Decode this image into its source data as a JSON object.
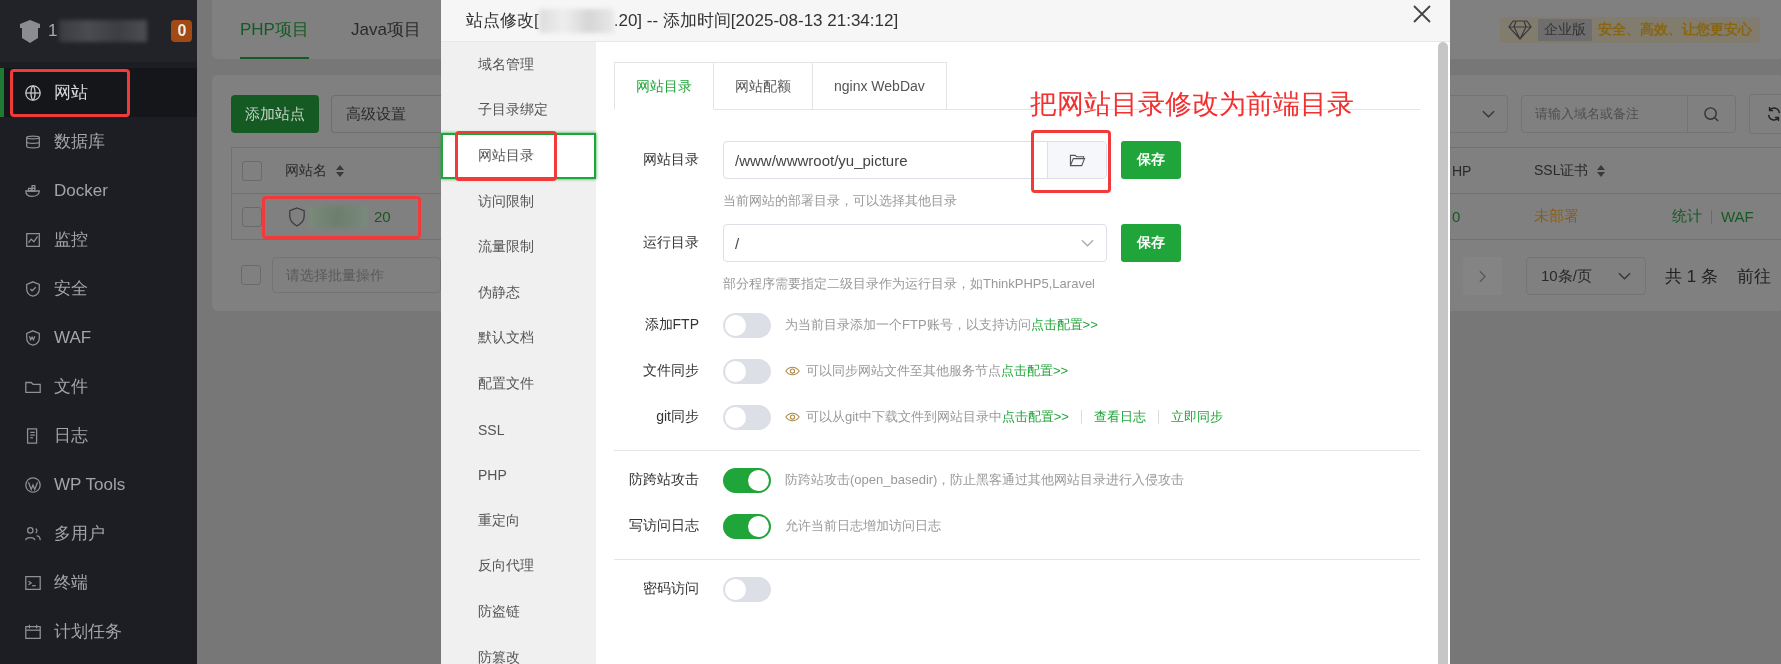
{
  "sidebar": {
    "brand_prefix": "1",
    "badge": "0",
    "items": [
      {
        "label": "网站",
        "selected": true,
        "annotated": true
      },
      {
        "label": "数据库",
        "selected": false,
        "annotated": false
      },
      {
        "label": "Docker",
        "selected": false,
        "annotated": false
      },
      {
        "label": "监控",
        "selected": false,
        "annotated": false
      },
      {
        "label": "安全",
        "selected": false,
        "annotated": false
      },
      {
        "label": "WAF",
        "selected": false,
        "annotated": false
      },
      {
        "label": "文件",
        "selected": false,
        "annotated": false
      },
      {
        "label": "日志",
        "selected": false,
        "annotated": false
      },
      {
        "label": "WP Tools",
        "selected": false,
        "annotated": false
      },
      {
        "label": "多用户",
        "selected": false,
        "annotated": false
      },
      {
        "label": "终端",
        "selected": false,
        "annotated": false
      },
      {
        "label": "计划任务",
        "selected": false,
        "annotated": false
      }
    ]
  },
  "background": {
    "tabs": [
      {
        "label": "PHP项目",
        "selected": true
      },
      {
        "label": "Java项目",
        "selected": false
      }
    ],
    "add_button": "添加站点",
    "advanced_button": "高级设置",
    "search_placeholder": "请输入域名或备注",
    "edition_badge": "企业版",
    "slogan": "安全、高效、让您更安心",
    "header_checkbox_checked": false,
    "table": {
      "columns": [
        "网站名",
        "HP",
        "SSL证书"
      ],
      "row": {
        "checked": false,
        "name_suffix": "20",
        "annotated": true,
        "php": "0",
        "ssl": "未部署",
        "actions": [
          "统计",
          "WAF"
        ]
      }
    },
    "batch_checkbox_checked": false,
    "batch_placeholder": "请选择批量操作",
    "page_size": "10条/页",
    "total": "共 1 条",
    "goto": "前往"
  },
  "modal": {
    "title_prefix": "站点修改[",
    "title_suffix": ".20] -- 添加时间[2025-08-13 21:34:12]",
    "nav": [
      {
        "label": "域名管理",
        "selected": false,
        "annotated": false
      },
      {
        "label": "子目录绑定",
        "selected": false,
        "annotated": false
      },
      {
        "label": "网站目录",
        "selected": true,
        "annotated": true
      },
      {
        "label": "访问限制",
        "selected": false,
        "annotated": false
      },
      {
        "label": "流量限制",
        "selected": false,
        "annotated": false
      },
      {
        "label": "伪静态",
        "selected": false,
        "annotated": false
      },
      {
        "label": "默认文档",
        "selected": false,
        "annotated": false
      },
      {
        "label": "配置文件",
        "selected": false,
        "annotated": false
      },
      {
        "label": "SSL",
        "selected": false,
        "annotated": false
      },
      {
        "label": "PHP",
        "selected": false,
        "annotated": false
      },
      {
        "label": "重定向",
        "selected": false,
        "annotated": false
      },
      {
        "label": "反向代理",
        "selected": false,
        "annotated": false
      },
      {
        "label": "防盗链",
        "selected": false,
        "annotated": false
      },
      {
        "label": "防篡改",
        "selected": false,
        "annotated": false
      }
    ],
    "tabs": [
      {
        "label": "网站目录",
        "selected": true
      },
      {
        "label": "网站配额",
        "selected": false
      },
      {
        "label": "nginx WebDav",
        "selected": false
      }
    ],
    "root_dir": {
      "label": "网站目录",
      "value": "/www/wwwroot/yu_picture",
      "hint": "当前网站的部署目录，可以选择其他目录",
      "save": "保存",
      "annotated": true
    },
    "run_dir": {
      "label": "运行目录",
      "value": "/",
      "hint": "部分程序需要指定二级目录作为运行目录，如ThinkPHP5,Laravel",
      "save": "保存"
    },
    "rows": [
      {
        "kind": "switch",
        "label": "添加FTP",
        "on": false,
        "tip_icon": false,
        "hint": "为当前目录添加一个FTP账号，以支持访问",
        "links": [
          "点击配置>>"
        ]
      },
      {
        "kind": "switch",
        "label": "文件同步",
        "on": false,
        "tip_icon": true,
        "hint": "可以同步网站文件至其他服务节点",
        "links": [
          "点击配置>>"
        ]
      },
      {
        "kind": "switch",
        "label": "git同步",
        "on": false,
        "tip_icon": true,
        "hint": "可以从git中下载文件到网站目录中",
        "links": [
          "点击配置>>",
          "查看日志",
          "立即同步"
        ]
      },
      {
        "kind": "divider"
      },
      {
        "kind": "switch",
        "label": "防跨站攻击",
        "on": true,
        "tip_icon": false,
        "hint": "防跨站攻击(open_basedir)，防止黑客通过其他网站目录进行入侵攻击",
        "links": []
      },
      {
        "kind": "switch",
        "label": "写访问日志",
        "on": true,
        "tip_icon": false,
        "hint": "允许当前日志增加访问日志",
        "links": []
      },
      {
        "kind": "divider"
      },
      {
        "kind": "switch",
        "label": "密码访问",
        "on": false,
        "tip_icon": false,
        "links": []
      }
    ]
  },
  "annotation": {
    "text": "把网站目录修改为前端目录"
  }
}
